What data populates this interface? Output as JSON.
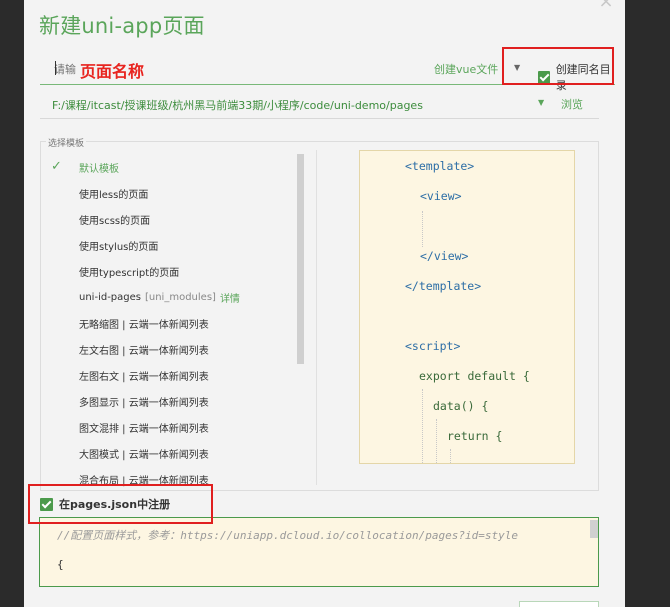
{
  "dialog": {
    "title": "新建uni-app页面",
    "close_symbol": "×"
  },
  "name_row": {
    "placeholder": "请输",
    "overlay_text": "页面名称",
    "vue_select": "创建vue文件",
    "same_dir_label": "创建同名目录"
  },
  "path_row": {
    "path": "F:/课程/itcast/授课班级/杭州黑马前端33期/小程序/code/uni-demo/pages",
    "browse_label": "浏览"
  },
  "templates": {
    "legend": "选择模板",
    "items": [
      {
        "label": "默认模板"
      },
      {
        "label": "使用less的页面"
      },
      {
        "label": "使用scss的页面"
      },
      {
        "label": "使用stylus的页面"
      },
      {
        "label": "使用typescript的页面"
      },
      {
        "label": "uni-id-pages",
        "sub": "[uni_modules]",
        "link": "详情"
      },
      {
        "label": "无略缩图 | 云端一体新闻列表"
      },
      {
        "label": "左文右图 | 云端一体新闻列表"
      },
      {
        "label": "左图右文 | 云端一体新闻列表"
      },
      {
        "label": "多图显示 | 云端一体新闻列表"
      },
      {
        "label": "图文混排 | 云端一体新闻列表"
      },
      {
        "label": "大图模式 | 云端一体新闻列表"
      },
      {
        "label": "混合布局 | 云端一体新闻列表"
      }
    ]
  },
  "preview": {
    "lines": [
      "<template>",
      "<view>",
      "</view>",
      "</template>",
      "<script>",
      "export default {",
      "data() {",
      "return {"
    ]
  },
  "pages_json": {
    "label": "在pages.json中注册",
    "comment": "//配置页面样式，参考：https://uniapp.dcloud.io/collocation/pages?id=style",
    "brace": "{"
  }
}
